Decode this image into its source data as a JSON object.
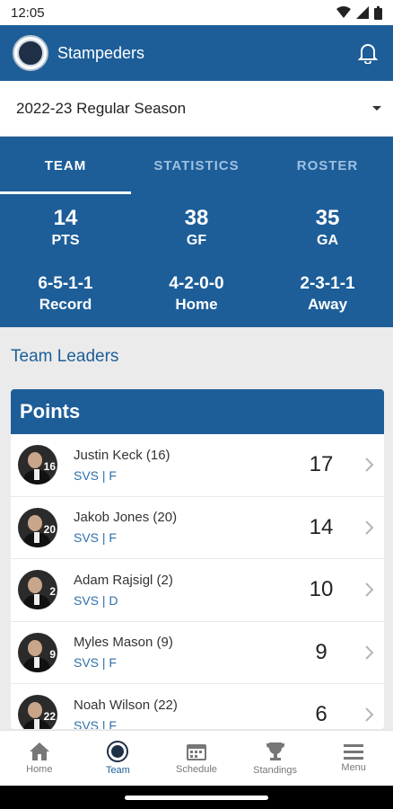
{
  "status_bar": {
    "time": "12:05"
  },
  "app_bar": {
    "title": "Stampeders",
    "logo_icon": "team-logo",
    "bell_icon": "bell-icon"
  },
  "season_selector": {
    "value": "2022-23 Regular Season"
  },
  "tabs": [
    {
      "label": "TEAM",
      "active": true
    },
    {
      "label": "STATISTICS",
      "active": false
    },
    {
      "label": "ROSTER",
      "active": false
    }
  ],
  "stats": {
    "row1": [
      {
        "value": "14",
        "label": "PTS"
      },
      {
        "value": "38",
        "label": "GF"
      },
      {
        "value": "35",
        "label": "GA"
      }
    ],
    "row2": [
      {
        "value": "6-5-1-1",
        "label": "Record"
      },
      {
        "value": "4-2-0-0",
        "label": "Home"
      },
      {
        "value": "2-3-1-1",
        "label": "Away"
      }
    ]
  },
  "section_title": "Team Leaders",
  "leaders_card": {
    "title": "Points",
    "players": [
      {
        "name": "Justin Keck (16)",
        "team": "SVS | F",
        "value": "17",
        "jersey": "16"
      },
      {
        "name": "Jakob Jones (20)",
        "team": "SVS | F",
        "value": "14",
        "jersey": "20"
      },
      {
        "name": "Adam Rajsigl (2)",
        "team": "SVS | D",
        "value": "10",
        "jersey": "2"
      },
      {
        "name": "Myles Mason (9)",
        "team": "SVS | F",
        "value": "9",
        "jersey": "9"
      },
      {
        "name": "Noah Wilson (22)",
        "team": "SVS | F",
        "value": "6",
        "jersey": "22"
      }
    ]
  },
  "bottom_nav": [
    {
      "label": "Home",
      "icon": "home-icon",
      "active": false
    },
    {
      "label": "Team",
      "icon": "team-logo-icon",
      "active": true
    },
    {
      "label": "Schedule",
      "icon": "calendar-icon",
      "active": false
    },
    {
      "label": "Standings",
      "icon": "trophy-icon",
      "active": false
    },
    {
      "label": "Menu",
      "icon": "menu-icon",
      "active": false
    }
  ],
  "colors": {
    "primary": "#1d5e99",
    "link": "#2f6fab",
    "background": "#ebebeb"
  }
}
